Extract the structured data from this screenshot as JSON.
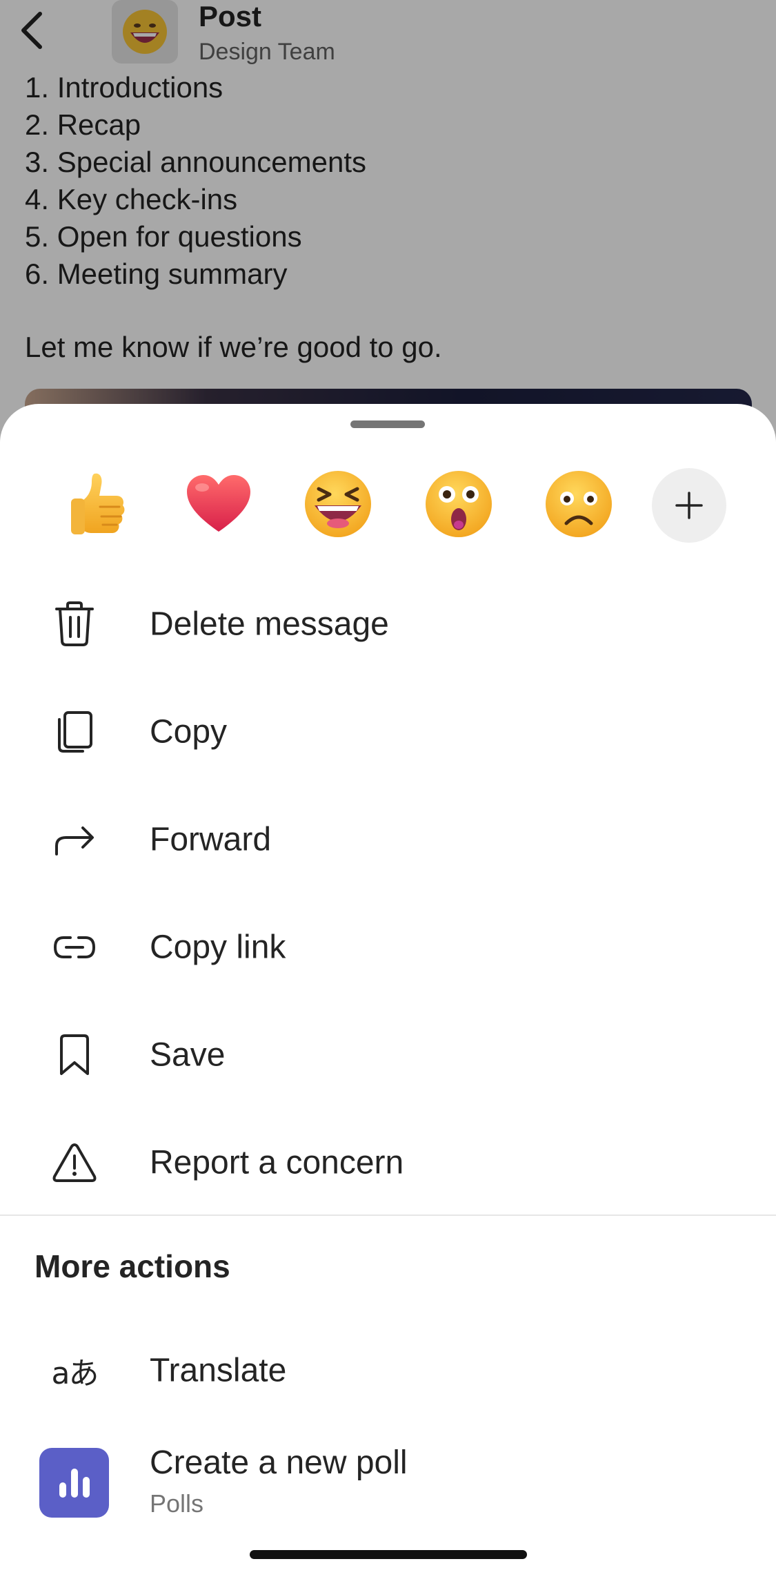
{
  "header": {
    "title": "Post",
    "subtitle": "Design Team"
  },
  "message": {
    "lines": [
      "1. Introductions",
      "2. Recap",
      "3. Special announcements",
      "4. Key check-ins",
      "5. Open for questions",
      "6. Meeting summary"
    ],
    "footer": "Let me know if we’re good to go."
  },
  "reactions": [
    {
      "icon": "thumbs-up-emoji"
    },
    {
      "icon": "heart-emoji"
    },
    {
      "icon": "laughing-emoji"
    },
    {
      "icon": "surprised-emoji"
    },
    {
      "icon": "sad-emoji"
    }
  ],
  "menu": {
    "delete": "Delete message",
    "copy": "Copy",
    "forward": "Forward",
    "copy_link": "Copy link",
    "save": "Save",
    "report": "Report a concern"
  },
  "more_actions": {
    "title": "More actions",
    "translate": "Translate",
    "translate_glyph": "aあ",
    "poll": "Create a new poll",
    "poll_sub": "Polls"
  },
  "colors": {
    "poll_accent": "#5b5fc7",
    "overlay": "rgba(0,0,0,0.34)"
  }
}
